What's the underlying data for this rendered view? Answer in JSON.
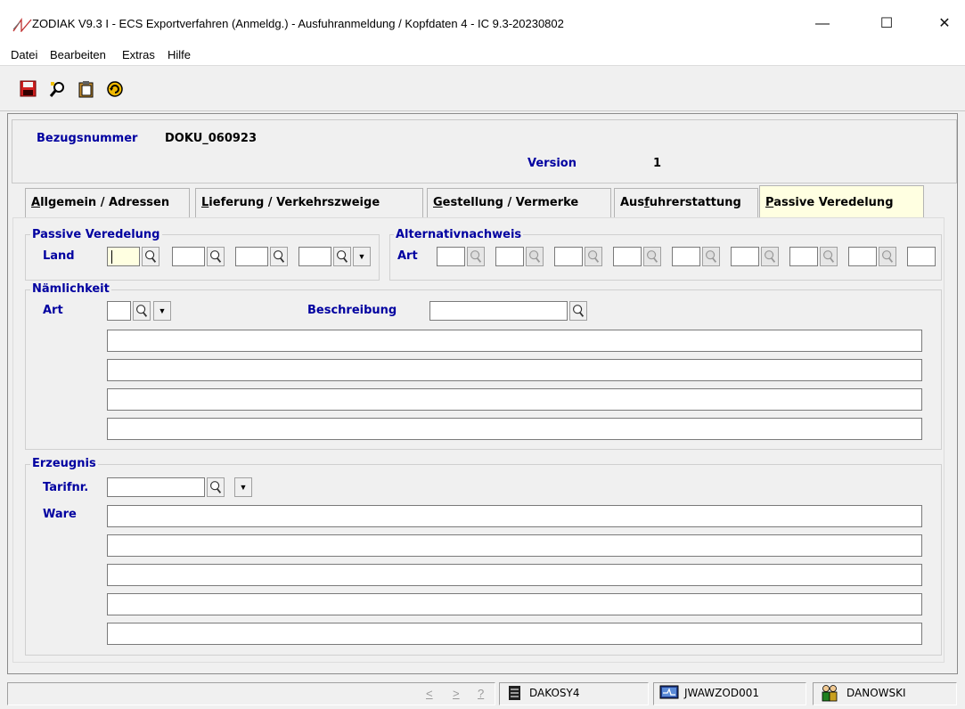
{
  "window": {
    "title": "ZODIAK V9.3 I - ECS Exportverfahren (Anmeldg.) - Ausfuhranmeldung / Kopfdaten 4 - IC 9.3-20230802",
    "minimize_glyph": "—",
    "maximize_glyph": "☐",
    "close_glyph": "✕"
  },
  "menu": {
    "datei": "Datei",
    "bearbeiten": "Bearbeiten",
    "extras": "Extras",
    "hilfe": "Hilfe"
  },
  "toolbar": {
    "icons": [
      "save-icon",
      "find-icon",
      "clipboard-icon",
      "refresh-icon"
    ]
  },
  "header": {
    "bezugsnummer_label": "Bezugsnummer",
    "bezugsnummer_value": "DOKU_060923",
    "version_label": "Version",
    "version_value": "1"
  },
  "tabs": [
    {
      "first": "A",
      "rest": "llgemein / Adressen",
      "active": false
    },
    {
      "first": "L",
      "rest": "ieferung / Verkehrszweige",
      "active": false
    },
    {
      "first": "G",
      "rest": "estellung / Vermerke",
      "active": false
    },
    {
      "pre": "Aus",
      "first": "f",
      "rest": "uhrerstattung",
      "active": false
    },
    {
      "first": "P",
      "rest": "assive Veredelung",
      "active": true
    }
  ],
  "passive_veredelung": {
    "legend": "Passive Veredelung",
    "land_label": "Land"
  },
  "alternativnachweis": {
    "legend": "Alternativnachweis",
    "art_label": "Art"
  },
  "naemlichkeit": {
    "legend": "Nämlichkeit",
    "art_label": "Art",
    "beschreibung_label": "Beschreibung"
  },
  "erzeugnis": {
    "legend": "Erzeugnis",
    "tarifnr_label": "Tarifnr.",
    "ware_label": "Ware"
  },
  "statusbar": {
    "nav_prev": "<",
    "nav_next": ">",
    "help": "?",
    "server": "DAKOSY4",
    "workstation": "JWAWZOD001",
    "user": "DANOWSKI"
  },
  "colors": {
    "label_blue": "#0000a0",
    "focus_yellow": "#ffffe1"
  }
}
